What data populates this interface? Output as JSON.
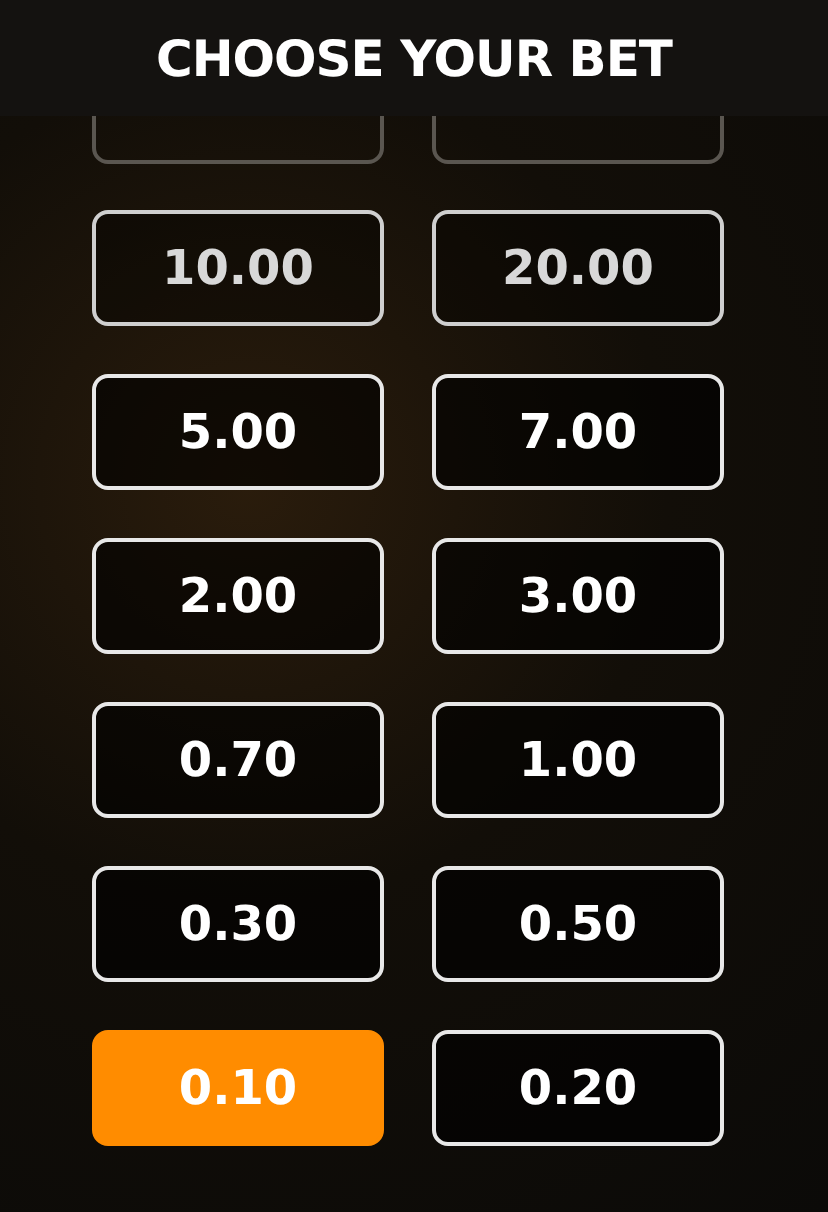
{
  "title": "CHOOSE YOUR BET",
  "bets": [
    {
      "label": "10.00",
      "selected": false
    },
    {
      "label": "20.00",
      "selected": false
    },
    {
      "label": "5.00",
      "selected": false
    },
    {
      "label": "7.00",
      "selected": false
    },
    {
      "label": "2.00",
      "selected": false
    },
    {
      "label": "3.00",
      "selected": false
    },
    {
      "label": "0.70",
      "selected": false
    },
    {
      "label": "1.00",
      "selected": false
    },
    {
      "label": "0.30",
      "selected": false
    },
    {
      "label": "0.50",
      "selected": false
    },
    {
      "label": "0.10",
      "selected": true
    },
    {
      "label": "0.20",
      "selected": false
    }
  ]
}
